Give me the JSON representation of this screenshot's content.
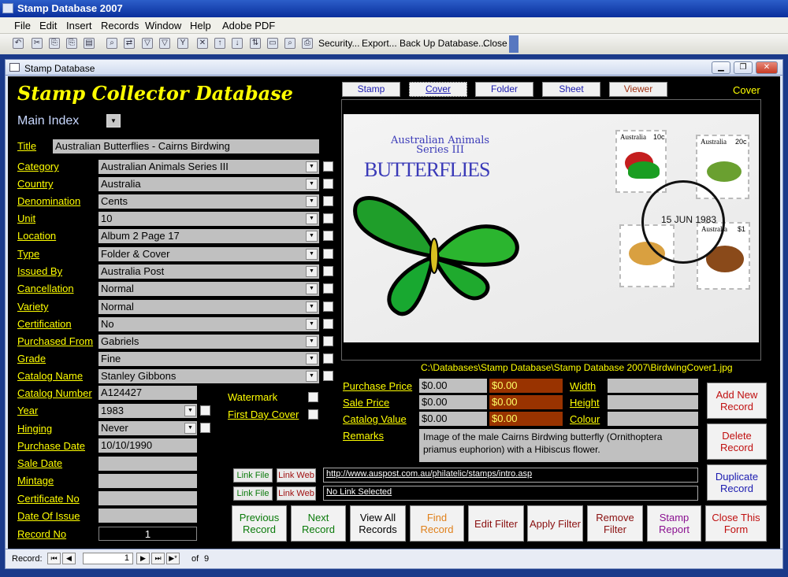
{
  "app": {
    "title": "Stamp Database 2007"
  },
  "menu": [
    "File",
    "Edit",
    "Insert",
    "Records",
    "Window",
    "Help",
    "Adobe PDF"
  ],
  "toolbar": {
    "items": [
      "Security...",
      "Export...",
      "Back Up Database...",
      "Close"
    ]
  },
  "window": {
    "title": "Stamp Database"
  },
  "form": {
    "heading": "Stamp Collector Database",
    "main_index": "Main Index",
    "title_label": "Title",
    "title_value": "Australian Butterflies - Cairns Birdwing",
    "fields": [
      {
        "label": "Category",
        "value": "Australian Animals Series III"
      },
      {
        "label": "Country",
        "value": "Australia"
      },
      {
        "label": "Denomination",
        "value": "Cents"
      },
      {
        "label": "Unit",
        "value": "10"
      },
      {
        "label": "Location",
        "value": "Album 2 Page 17"
      },
      {
        "label": "Type",
        "value": "Folder & Cover"
      },
      {
        "label": "Issued By",
        "value": "Australia Post"
      },
      {
        "label": "Cancellation",
        "value": "Normal"
      },
      {
        "label": "Variety",
        "value": "Normal"
      },
      {
        "label": "Certification",
        "value": "No"
      },
      {
        "label": "Purchased From",
        "value": "Gabriels"
      },
      {
        "label": "Grade",
        "value": "Fine"
      },
      {
        "label": "Catalog Name",
        "value": "Stanley Gibbons"
      }
    ],
    "catalog_number": {
      "label": "Catalog Number",
      "value": "A124427"
    },
    "year": {
      "label": "Year",
      "value": "1983"
    },
    "hinging": {
      "label": "Hinging",
      "value": "Never"
    },
    "purchase_date": {
      "label": "Purchase Date",
      "value": "10/10/1990"
    },
    "sale_date": {
      "label": "Sale Date",
      "value": ""
    },
    "mintage": {
      "label": "Mintage",
      "value": ""
    },
    "certificate_no": {
      "label": "Certificate No",
      "value": ""
    },
    "date_of_issue": {
      "label": "Date Of Issue",
      "value": ""
    },
    "record_no": {
      "label": "Record No",
      "value": "1"
    },
    "watermark": "Watermark",
    "first_day_cover": "First Day Cover",
    "image_tabs": [
      "Stamp",
      "Cover",
      "Folder",
      "Sheet",
      "Viewer"
    ],
    "image_mode": "Cover",
    "image_path": "C:\\Databases\\Stamp Database\\Stamp Database 2007\\BirdwingCover1.jpg",
    "cover_text": {
      "series1": "Australian Animals",
      "series2": "Series III",
      "title": "BUTTERFLIES",
      "postmark": "15 JUN 1983",
      "stamp_country": "Australia",
      "stamp_vals": [
        "10c",
        "20c",
        "$1"
      ]
    },
    "prices": [
      {
        "label": "Purchase Price",
        "value": "$0.00",
        "value2": "$0.00",
        "dim_label": "Width"
      },
      {
        "label": "Sale Price",
        "value": "$0.00",
        "value2": "$0.00",
        "dim_label": "Height"
      },
      {
        "label": "Catalog Value",
        "value": "$0.00",
        "value2": "$0.00",
        "dim_label": "Colour"
      }
    ],
    "remarks_label": "Remarks",
    "remarks": "Image of the male Cairns Birdwing butterfly (Ornithoptera priamus euphorion) with a Hibiscus flower.",
    "link_file": "Link File",
    "link_web": "Link Web",
    "link1": "http://www.auspost.com.au/philatelic/stamps/intro.asp",
    "link2": "No Link Selected",
    "bottom_buttons": [
      {
        "line1": "Previous",
        "line2": "Record"
      },
      {
        "line1": "Next",
        "line2": "Record"
      },
      {
        "line1": "View All",
        "line2": "Records"
      },
      {
        "line1": "Find",
        "line2": "Record"
      },
      {
        "line1": "Edit Filter",
        "line2": ""
      },
      {
        "line1": "Apply Filter",
        "line2": ""
      },
      {
        "line1": "Remove",
        "line2": "Filter"
      },
      {
        "line1": "Stamp",
        "line2": "Report"
      },
      {
        "line1": "Close This",
        "line2": "Form"
      }
    ],
    "right_buttons": [
      {
        "line1": "Add New",
        "line2": "Record"
      },
      {
        "line1": "Delete",
        "line2": "Record"
      },
      {
        "line1": "Duplicate",
        "line2": "Record"
      }
    ]
  },
  "status": {
    "record_label": "Record:",
    "current": "1",
    "of_label": "of",
    "total": "9"
  },
  "colors": {
    "label": "#ffff00",
    "background": "#000000",
    "field": "#c0c0c0",
    "orange_field": "#993300"
  }
}
